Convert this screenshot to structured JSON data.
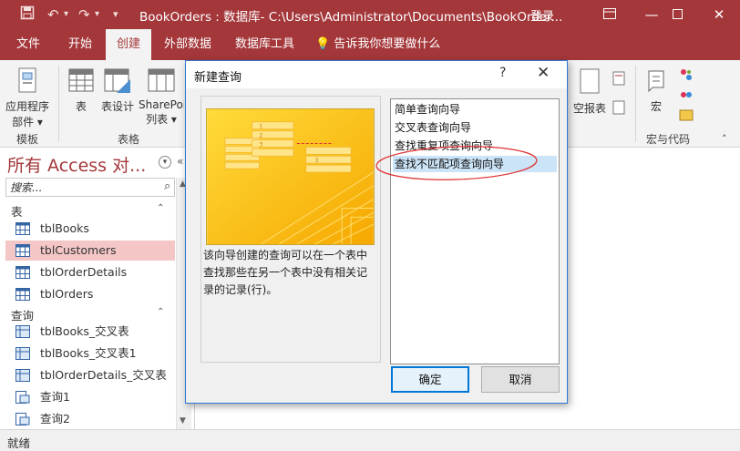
{
  "window": {
    "title": "BookOrders : 数据库- C:\\Users\\Administrator\\Documents\\BookOrder...",
    "sign_in": "登录"
  },
  "icons": {
    "save": "save-icon",
    "undo": "undo-icon",
    "redo": "redo-icon",
    "qat_more": "customize-qat-icon",
    "minimize": "minimize-icon",
    "restore": "restore-icon",
    "close": "close-icon",
    "lightbulb": "lightbulb-icon",
    "table": "table-icon",
    "query": "query-icon"
  },
  "ribbon": {
    "tabs": [
      "文件",
      "开始",
      "创建",
      "外部数据",
      "数据库工具"
    ],
    "active_tab": "创建",
    "tell_me": "告诉我你想要做什么",
    "buttons": {
      "app_parts": "应用程序",
      "app_parts_2": "部件",
      "table": "表",
      "table_design": "表设计",
      "sharepoint": "SharePoi",
      "sharepoint_2": "列表",
      "blank_report": "空报表",
      "macro": "宏"
    },
    "groups": {
      "templates": "模板",
      "tables": "表格",
      "macros_code": "宏与代码"
    }
  },
  "nav": {
    "title": "所有 Access 对...",
    "search_placeholder": "搜索...",
    "categories": {
      "tables": "表",
      "queries": "查询"
    },
    "tables": [
      "tblBooks",
      "tblCustomers",
      "tblOrderDetails",
      "tblOrders"
    ],
    "selected": "tblCustomers",
    "queries": [
      "tblBooks_交叉表",
      "tblBooks_交叉表1",
      "tblOrderDetails_交叉表",
      "查询1",
      "查询2"
    ]
  },
  "status": {
    "text": "就绪"
  },
  "dialog": {
    "title": "新建查询",
    "help": "?",
    "description": "该向导创建的查询可以在一个表中查找那些在另一个表中没有相关记录的记录(行)。",
    "wizards": [
      "简单查询向导",
      "交叉表查询向导",
      "查找重复项查询向导",
      "查找不匹配项查询向导"
    ],
    "selected_wizard": "查找不匹配项查询向导",
    "ok": "确定",
    "cancel": "取消"
  },
  "colors": {
    "accent": "#a4373a",
    "selection_nav": "#f4c6c6",
    "selection_list": "#cce4f7",
    "dialog_border": "#2b79d7",
    "annotation": "#e03030"
  }
}
